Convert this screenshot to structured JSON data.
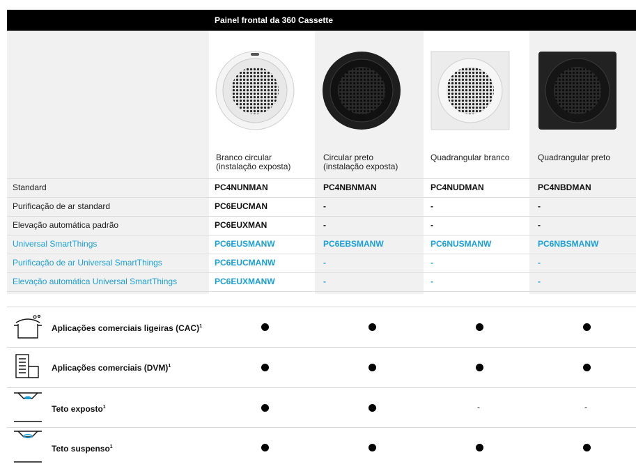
{
  "header": {
    "title": "Painel frontal da 360 Cassette"
  },
  "columns": [
    {
      "label_line1": "Branco circular",
      "label_line2": "(instalação exposta)"
    },
    {
      "label_line1": "Circular preto",
      "label_line2": "(instalação exposta)"
    },
    {
      "label_line1": "Quadrangular branco",
      "label_line2": ""
    },
    {
      "label_line1": "Quadrangular preto",
      "label_line2": ""
    }
  ],
  "rows": [
    {
      "label": "Standard",
      "blue": false,
      "cells": [
        "PC4NUNMAN",
        "PC4NBNMAN",
        "PC4NUDMAN",
        "PC4NBDMAN"
      ]
    },
    {
      "label": "Purificação de ar standard",
      "blue": false,
      "cells": [
        "PC6EUCMAN",
        "-",
        "-",
        "-"
      ]
    },
    {
      "label": "Elevação automática padrão",
      "blue": false,
      "cells": [
        "PC6EUXMAN",
        "-",
        "-",
        "-"
      ]
    },
    {
      "label": "Universal SmartThings",
      "blue": true,
      "cells": [
        "PC6EUSMANW",
        "PC6EBSMANW",
        "PC6NUSMANW",
        "PC6NBSMANW"
      ]
    },
    {
      "label": "Purificação de ar Universal SmartThings",
      "blue": true,
      "cells": [
        "PC6EUCMANW",
        "-",
        "-",
        "-"
      ]
    },
    {
      "label": "Elevação automática Universal SmartThings",
      "blue": true,
      "cells": [
        "PC6EUXMANW",
        "-",
        "-",
        "-"
      ]
    }
  ],
  "features": [
    {
      "label": "Aplicações comerciais ligeiras (CAC)",
      "sup": "1",
      "icon": "cooking-pot-icon",
      "cells": [
        "dot",
        "dot",
        "dot",
        "dot"
      ]
    },
    {
      "label": "Aplicações comerciais (DVM)",
      "sup": "1",
      "icon": "building-icon",
      "cells": [
        "dot",
        "dot",
        "dot",
        "dot"
      ]
    },
    {
      "label": "Teto exposto",
      "sup": "1",
      "icon": "exposed-ceiling-icon",
      "cells": [
        "dot",
        "dot",
        "-",
        "-"
      ]
    },
    {
      "label": "Teto suspenso",
      "sup": "1",
      "icon": "suspended-ceiling-icon",
      "cells": [
        "dot",
        "dot",
        "dot",
        "dot"
      ]
    }
  ],
  "colors": {
    "header_bg": "#000000",
    "shade_bg": "#f1f1f1",
    "accent_blue": "#1aa0d8"
  }
}
